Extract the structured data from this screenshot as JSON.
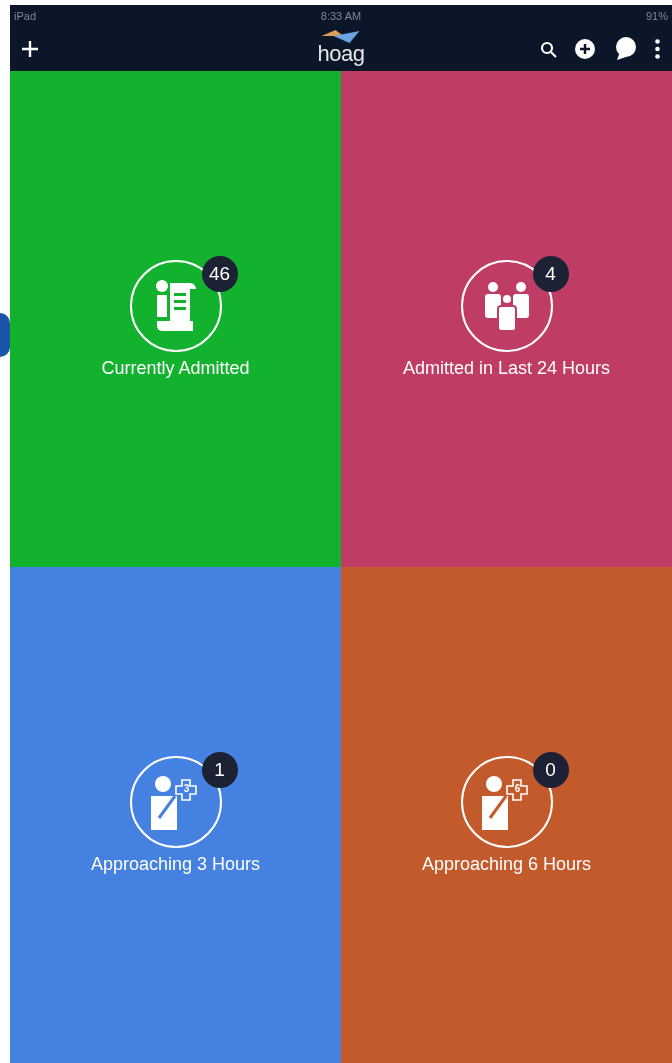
{
  "status_bar": {
    "device": "iPad",
    "time": "8:33 AM",
    "battery": "91%"
  },
  "nav_bar": {
    "logo": "hoag"
  },
  "tiles": [
    {
      "kind": "document",
      "label": "Currently Admitted",
      "count": "46",
      "color": "#12b22e"
    },
    {
      "kind": "family",
      "label": "Admitted in Last 24 Hours",
      "count": "4",
      "color": "#bf3c64"
    },
    {
      "kind": "patient",
      "label": "Approaching 3 Hours",
      "count": "1",
      "icon_number": "3",
      "color": "#4581e0"
    },
    {
      "kind": "patient",
      "label": "Approaching 6 Hours",
      "count": "0",
      "icon_number": "6",
      "color": "#c35a2c"
    }
  ]
}
